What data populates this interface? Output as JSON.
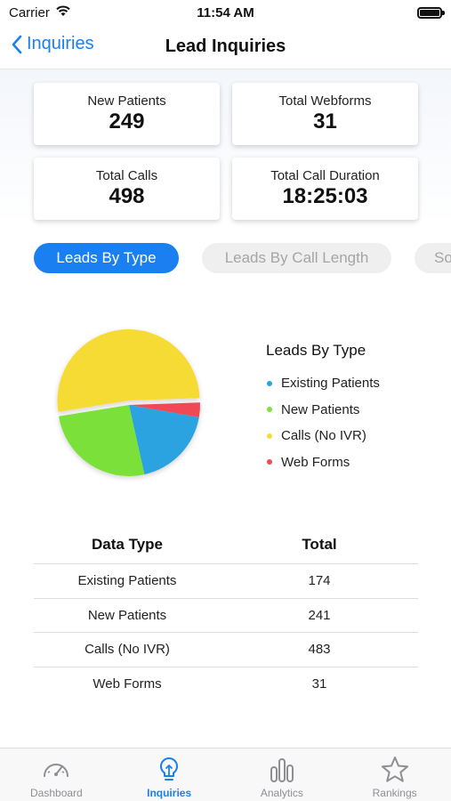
{
  "status_bar": {
    "carrier": "Carrier",
    "time": "11:54 AM"
  },
  "nav": {
    "back_label": "Inquiries",
    "title": "Lead Inquiries"
  },
  "stats": [
    {
      "label": "New Patients",
      "value": "249"
    },
    {
      "label": "Total Webforms",
      "value": "31"
    },
    {
      "label": "Total Calls",
      "value": "498"
    },
    {
      "label": "Total Call Duration",
      "value": "18:25:03"
    }
  ],
  "segments": [
    {
      "label": "Leads By Type",
      "active": true
    },
    {
      "label": "Leads By Call Length",
      "active": false
    },
    {
      "label": "So",
      "active": false
    }
  ],
  "chart_data": {
    "type": "pie",
    "title": "Leads By Type",
    "slices": [
      {
        "name": "Existing Patients",
        "value": 174,
        "color": "#2aa3e0"
      },
      {
        "name": "New Patients",
        "value": 241,
        "color": "#7be03a"
      },
      {
        "name": "Calls (No IVR)",
        "value": 483,
        "color": "#f7db35"
      },
      {
        "name": "Web Forms",
        "value": 31,
        "color": "#f04a55"
      }
    ]
  },
  "table": {
    "headers": [
      "Data Type",
      "Total"
    ],
    "rows": [
      [
        "Existing Patients",
        "174"
      ],
      [
        "New Patients",
        "241"
      ],
      [
        "Calls (No IVR)",
        "483"
      ],
      [
        "Web Forms",
        "31"
      ]
    ]
  },
  "tabs": [
    {
      "label": "Dashboard",
      "icon": "speedometer-icon",
      "active": false
    },
    {
      "label": "Inquiries",
      "icon": "lightbulb-icon",
      "active": true
    },
    {
      "label": "Analytics",
      "icon": "bar-chart-icon",
      "active": false
    },
    {
      "label": "Rankings",
      "icon": "star-icon",
      "active": false
    }
  ]
}
